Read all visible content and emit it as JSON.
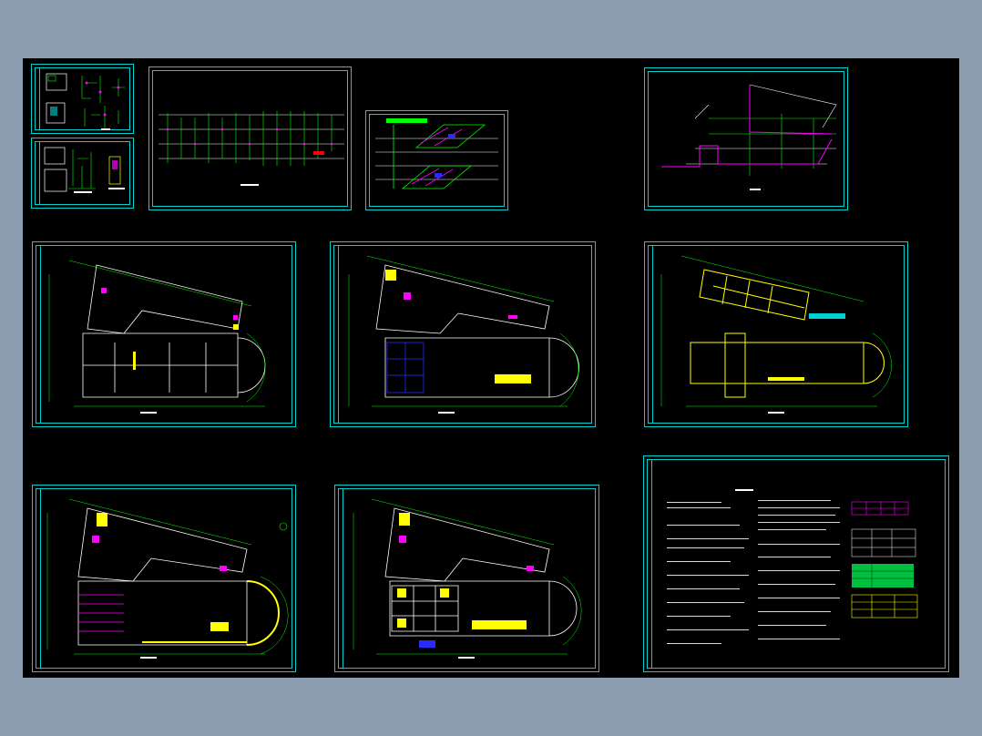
{
  "viewer": {
    "canvas_background": "#000000",
    "app_background": "#8c9db1"
  },
  "colors": {
    "frame": "#00d0d0",
    "wall": "#ffffff",
    "pipe_green": "#00ff00",
    "pipe_magenta": "#ff00ff",
    "fixture_yellow": "#ffff00",
    "room_blue": "#2a2aff"
  },
  "sheets": [
    {
      "id": "detail-a",
      "kind": "detail",
      "label": ""
    },
    {
      "id": "detail-b",
      "kind": "detail",
      "label": ""
    },
    {
      "id": "riser-diagram",
      "kind": "riser",
      "label": ""
    },
    {
      "id": "isometric",
      "kind": "isometric",
      "label": ""
    },
    {
      "id": "system-diagram",
      "kind": "system",
      "label": ""
    },
    {
      "id": "plan-1",
      "kind": "plan",
      "label": ""
    },
    {
      "id": "plan-2",
      "kind": "plan",
      "label": ""
    },
    {
      "id": "plan-3",
      "kind": "plan",
      "label": ""
    },
    {
      "id": "plan-4",
      "kind": "plan",
      "label": ""
    },
    {
      "id": "plan-5",
      "kind": "plan",
      "label": ""
    },
    {
      "id": "notes",
      "kind": "notes",
      "label": ""
    }
  ]
}
